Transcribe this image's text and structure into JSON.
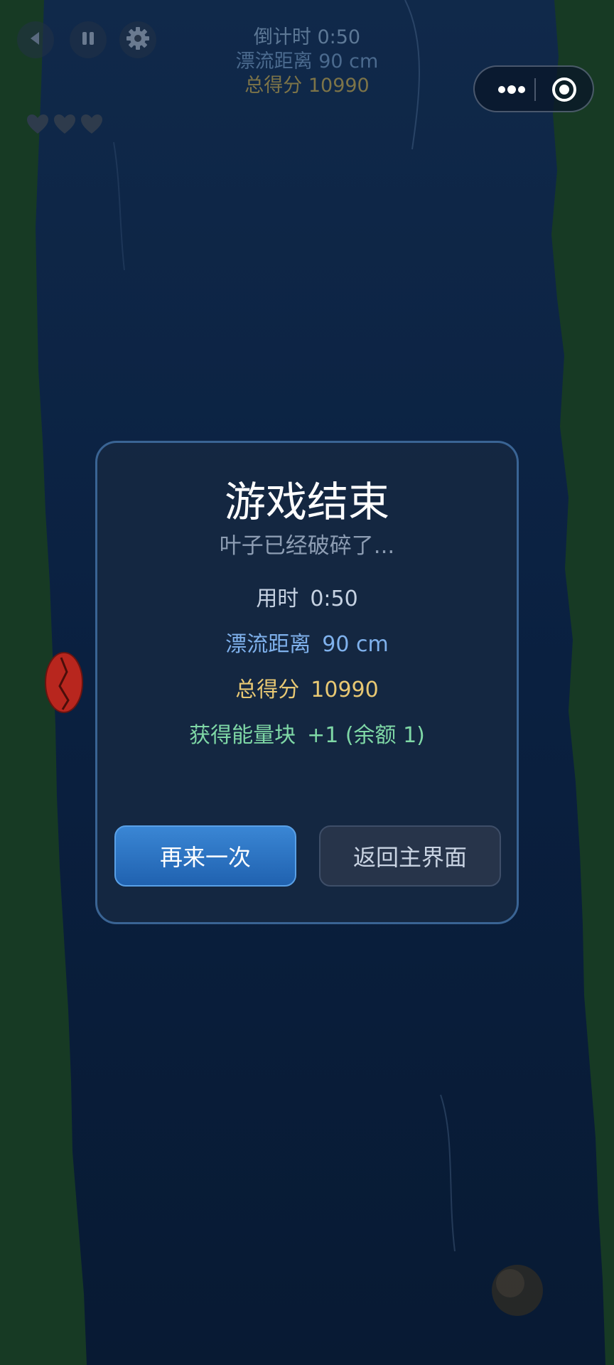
{
  "hud": {
    "countdown": "倒计时 0:50",
    "distance": "漂流距离 90 cm",
    "score": "总得分 10990",
    "back_icon": "back-arrow-icon",
    "pause_icon": "pause-icon",
    "settings_icon": "gear-icon",
    "lives": 3
  },
  "capsule": {
    "more_icon": "more-dots-icon",
    "close_icon": "target-close-icon"
  },
  "modal": {
    "title": "游戏结束",
    "subtitle": "叶子已经破碎了...",
    "stats": {
      "time_label": "用时",
      "time_value": "0:50",
      "distance_label": "漂流距离",
      "distance_value": "90 cm",
      "score_label": "总得分",
      "score_value": "10990",
      "energy_label": "获得能量块",
      "energy_value": "+1 (余额 1)"
    },
    "retry_button": "再来一次",
    "home_button": "返回主界面"
  },
  "colors": {
    "grass": "#173a24",
    "river": "#0a1f3b",
    "modal_border": "#3a6494",
    "retry_button": "#2a72c4",
    "score_gold": "#e8c873",
    "energy_green": "#7fd8a6",
    "distance_blue": "#7fb1ec"
  }
}
